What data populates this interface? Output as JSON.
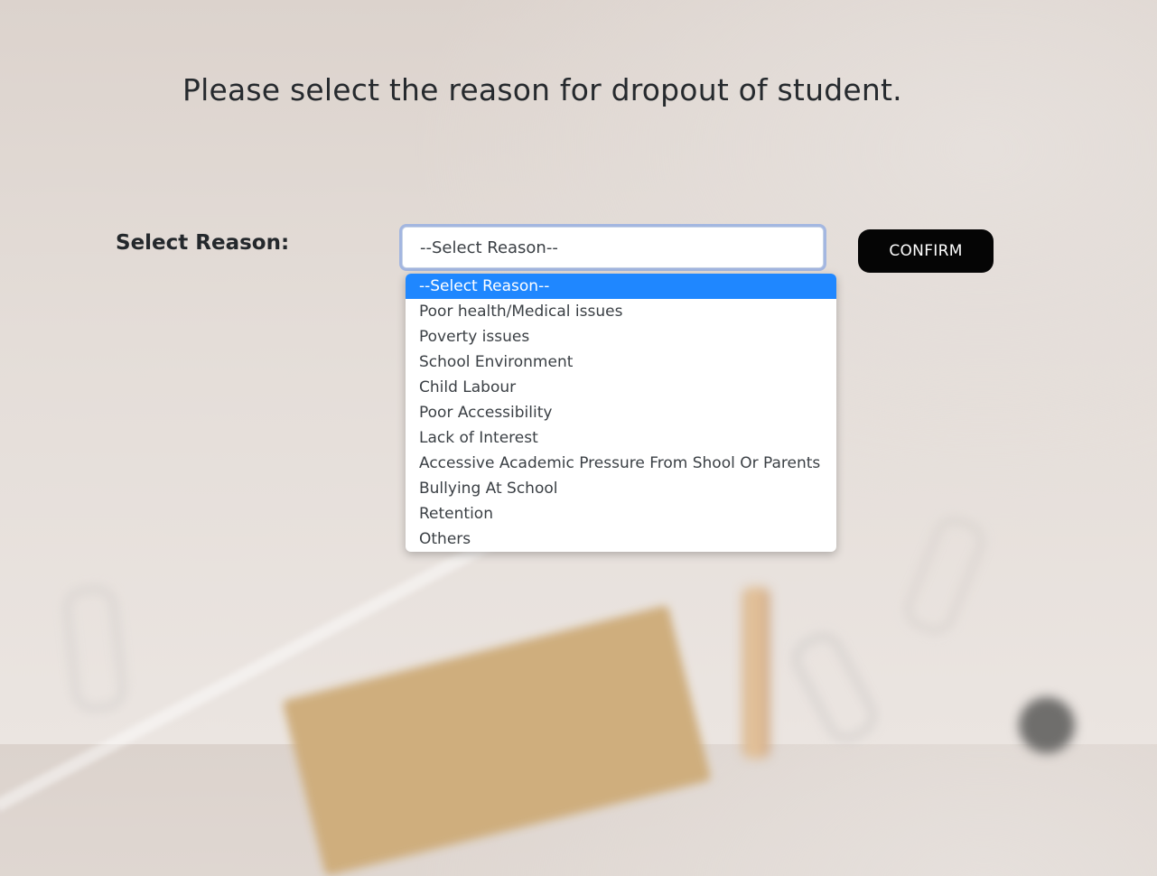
{
  "page": {
    "title": "Please select the reason for dropout of student."
  },
  "form": {
    "label": "Select Reason:",
    "select_value": "--Select Reason--",
    "confirm_label": "CONFIRM"
  },
  "dropdown": {
    "selected_index": 0,
    "highlight_color": "#1f87ff",
    "options": [
      "--Select Reason--",
      "Poor health/Medical issues",
      "Poverty issues",
      "School Environment",
      "Child Labour",
      "Poor Accessibility",
      "Lack of Interest",
      "Accessive Academic Pressure From Shool Or Parents",
      "Bullying At School",
      "Retention",
      "Others"
    ]
  }
}
